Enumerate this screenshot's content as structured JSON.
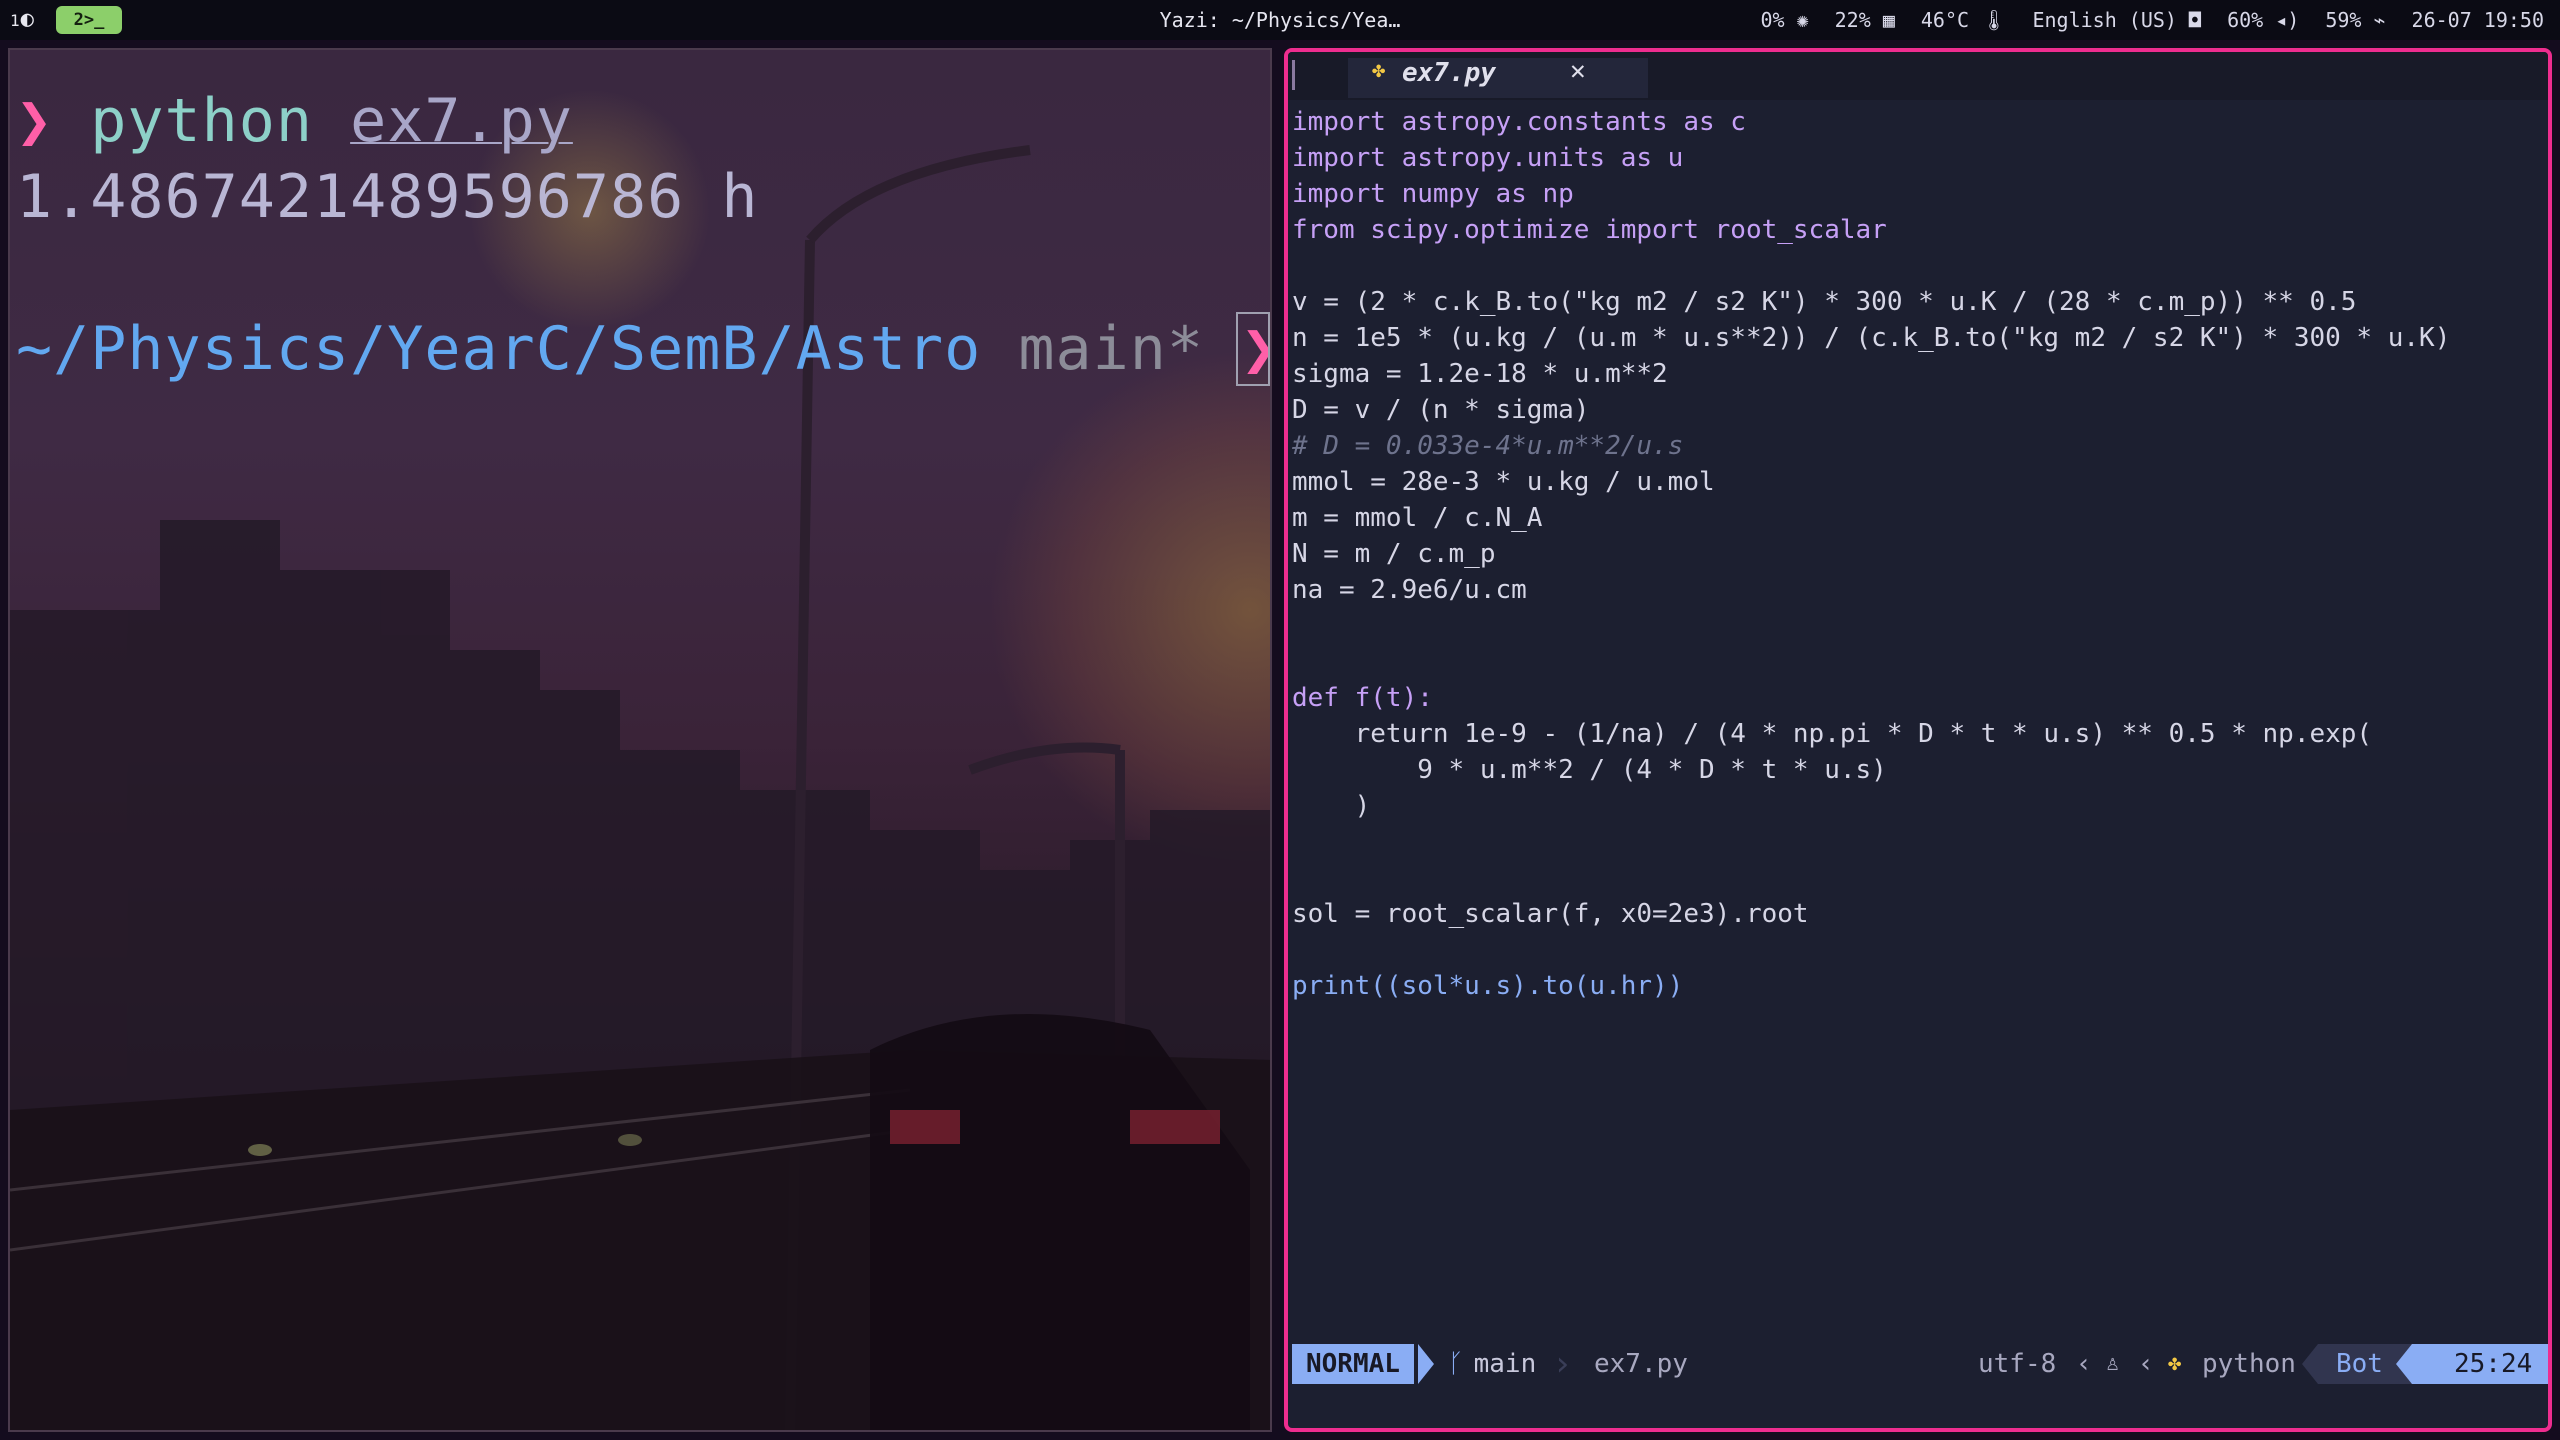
{
  "topbar": {
    "workspace1_label": "1",
    "workspace1_icon": "moon-icon",
    "workspace2_label": "2>_",
    "window_title": "Yazi: ~/Physics/Yea…",
    "cpu": "0%",
    "memory": "22%",
    "temperature": "46°C",
    "keyboard_layout": "English (US)",
    "brightness": "60%",
    "volume": "59%",
    "datetime": "26-07 19:50"
  },
  "terminal": {
    "prompt_symbol": "❯",
    "command_program": "python",
    "command_arg": "ex7.py",
    "output": "1.4867421489596786 h",
    "cwd": "~/Physics/YearC/SemB/Astro",
    "git_branch": "main*",
    "prompt_symbol2": "❯"
  },
  "editor": {
    "tab_name": "ex7.py",
    "tab_close": "✕",
    "mode": "NORMAL",
    "branch": "main",
    "file_name": "ex7.py",
    "encoding": "utf-8",
    "filetype": "python",
    "position": "Bot",
    "cursor_pos": "25:24",
    "code_lines": [
      "import astropy.constants as c",
      "import astropy.units as u",
      "import numpy as np",
      "from scipy.optimize import root_scalar",
      "",
      "v = (2 * c.k_B.to(\"kg m2 / s2 K\") * 300 * u.K / (28 * c.m_p)) ** 0.5",
      "n = 1e5 * (u.kg / (u.m * u.s**2)) / (c.k_B.to(\"kg m2 / s2 K\") * 300 * u.K)",
      "sigma = 1.2e-18 * u.m**2",
      "D = v / (n * sigma)",
      "# D = 0.033e-4*u.m**2/u.s",
      "mmol = 28e-3 * u.kg / u.mol",
      "m = mmol / c.N_A",
      "N = m / c.m_p",
      "na = 2.9e6/u.cm",
      "",
      "",
      "def f(t):",
      "    return 1e-9 - (1/na) / (4 * np.pi * D * t * u.s) ** 0.5 * np.exp(",
      "        9 * u.m**2 / (4 * D * t * u.s)",
      "    )",
      "",
      "",
      "sol = root_scalar(f, x0=2e3).root",
      "",
      "print((sol*u.s).to(u.hr))"
    ]
  }
}
